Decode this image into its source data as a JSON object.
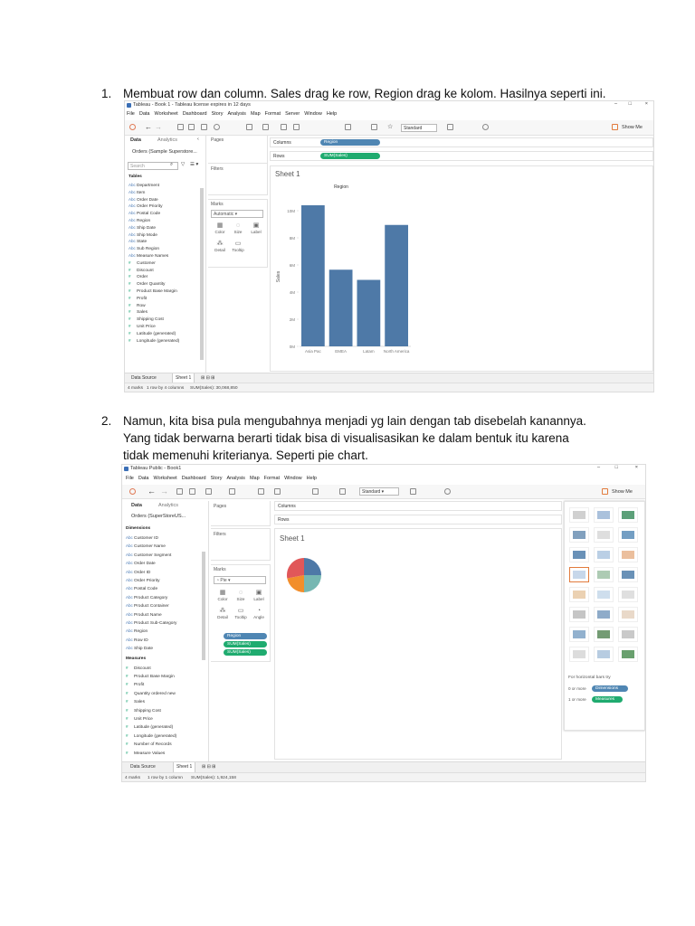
{
  "steps": [
    {
      "number": "1.",
      "text": "Membuat row dan column. Sales drag ke row, Region drag ke kolom. Hasilnya seperti ini."
    },
    {
      "number": "2.",
      "text": "Namun, kita bisa pula mengubahnya menjadi yg lain dengan tab disebelah kanannya. Yang tidak berwarna berarti tidak bisa di visualisasikan ke dalam bentuk itu karena tidak memenuhi kriterianya. Seperti pie chart."
    }
  ],
  "shot1": {
    "window_title": "Tableau - Book 1 - Tableau license expires in 12 days",
    "menu": [
      "File",
      "Data",
      "Worksheet",
      "Dashboard",
      "Story",
      "Analysis",
      "Map",
      "Format",
      "Server",
      "Window",
      "Help"
    ],
    "toolbar": {
      "standard": "Standard",
      "show_me": "Show Me"
    },
    "data_tab": "Data",
    "analytics_tab": "Analytics",
    "datasource": "Orders (Sample Superstore...",
    "search_placeholder": "Search",
    "tables_header": "Tables",
    "dimensions": [
      "Department",
      "Item",
      "Order Date",
      "Order Priority",
      "Postal Code",
      "Region",
      "Ship Date",
      "Ship Mode",
      "State",
      "Sub Region",
      "Measure Names"
    ],
    "measures": [
      "Customer",
      "Discount",
      "Order",
      "Order Quantity",
      "Product Base Margin",
      "Profit",
      "Row",
      "Sales",
      "Shipping Cost",
      "Unit Price",
      "Latitude (generated)",
      "Longitude (generated)"
    ],
    "pages_label": "Pages",
    "filters_label": "Filters",
    "marks_label": "Marks",
    "marks_type": "Automatic",
    "marks_buttons": [
      "Color",
      "Size",
      "Label",
      "Detail",
      "Tooltip"
    ],
    "columns_label": "Columns",
    "rows_label": "Rows",
    "columns_pill": "Region",
    "rows_pill": "SUM(Sales)",
    "sheet_title": "Sheet 1",
    "sheet_tabs": [
      "Data Source",
      "Sheet 1"
    ],
    "status": [
      "4 marks",
      "1 row by 4 columns",
      "SUM(Sales): 30,068,850"
    ]
  },
  "shot2": {
    "window_title": "Tableau Public - Book1",
    "menu": [
      "File",
      "Data",
      "Worksheet",
      "Dashboard",
      "Story",
      "Analysis",
      "Map",
      "Format",
      "Window",
      "Help"
    ],
    "toolbar": {
      "standard": "Standard",
      "show_me": "Show Me"
    },
    "data_tab": "Data",
    "analytics_tab": "Analytics",
    "datasource": "Orders (SuperStoreUS...",
    "dimensions_header": "Dimensions",
    "dimensions": [
      "Customer ID",
      "Customer Name",
      "Customer Segment",
      "Order Date",
      "Order ID",
      "Order Priority",
      "Postal Code",
      "Product Category",
      "Product Container",
      "Product Name",
      "Product Sub-Category",
      "Region",
      "Row ID",
      "Ship Date"
    ],
    "measures_header": "Measures",
    "measures": [
      "Discount",
      "Product Base Margin",
      "Profit",
      "Quantity ordered new",
      "Sales",
      "Shipping Cost",
      "Unit Price",
      "Latitude (generated)",
      "Longitude (generated)",
      "Number of Records",
      "Measure Values"
    ],
    "pages_label": "Pages",
    "filters_label": "Filters",
    "marks_label": "Marks",
    "marks_type": "Pie",
    "marks_buttons": [
      "Color",
      "Size",
      "Label",
      "Detail",
      "Tooltip",
      "Angle"
    ],
    "marks_pills": [
      "Region",
      "SUM(Sales)",
      "SUM(Sales)"
    ],
    "columns_label": "Columns",
    "rows_label": "Rows",
    "sheet_title": "Sheet 1",
    "showme_hint": "For horizontal bars try",
    "showme_rows": [
      {
        "label": "0 or more",
        "pill": "Dimensions"
      },
      {
        "label": "1 or more",
        "pill": "Measures"
      }
    ],
    "sheet_tabs": [
      "Data Source",
      "Sheet 1"
    ],
    "status": [
      "4 marks",
      "1 row by 1 column",
      "SUM(Sales): 1,924,158"
    ]
  },
  "chart_data": [
    {
      "type": "bar",
      "title": "Region",
      "ylabel": "Sales",
      "categories": [
        "Asia Pac",
        "EMEA",
        "Latam",
        "North America"
      ],
      "values": [
        10400000,
        5650000,
        4900000,
        8950000
      ],
      "ylim": [
        0,
        11000000
      ],
      "yticks": [
        "0M",
        "2M",
        "4M",
        "6M",
        "8M",
        "10M"
      ],
      "colors": {
        "bar": "#4e79a7"
      }
    },
    {
      "type": "pie",
      "title": "",
      "values": [
        25,
        25,
        22,
        28
      ],
      "colors": [
        "#4e79a7",
        "#76b7b2",
        "#f28e2b",
        "#e15759"
      ]
    }
  ]
}
